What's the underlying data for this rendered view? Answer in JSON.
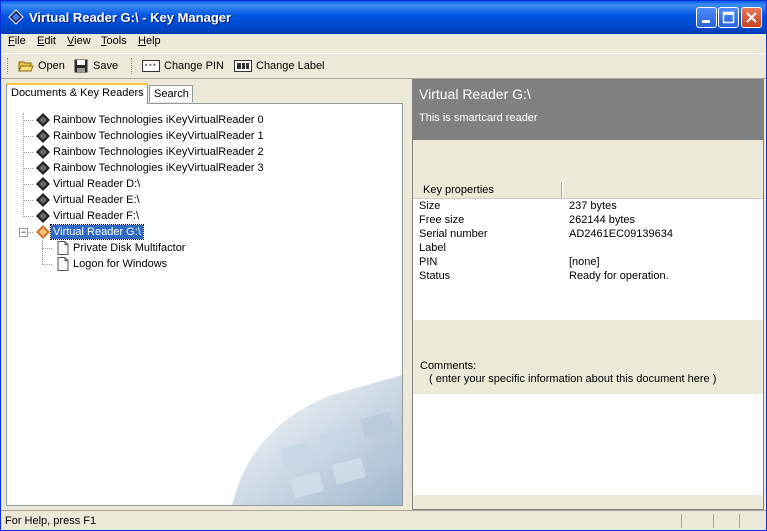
{
  "window": {
    "title": "Virtual Reader  G:\\ - Key Manager"
  },
  "menu": [
    {
      "label": "File",
      "accel": "F",
      "rest": "ile"
    },
    {
      "label": "Edit",
      "accel": "E",
      "rest": "dit"
    },
    {
      "label": "View",
      "accel": "V",
      "rest": "iew"
    },
    {
      "label": "Tools",
      "accel": "T",
      "rest": "ools"
    },
    {
      "label": "Help",
      "accel": "H",
      "rest": "elp"
    }
  ],
  "toolbar": {
    "open_label": "Open",
    "save_label": "Save",
    "change_pin_label": "Change PIN",
    "change_label_label": "Change Label"
  },
  "tabs": {
    "documents": "Documents & Key Readers",
    "search": "Search"
  },
  "tree": {
    "readers": [
      "Rainbow Technologies iKeyVirtualReader 0",
      "Rainbow Technologies iKeyVirtualReader 1",
      "Rainbow Technologies iKeyVirtualReader 2",
      "Rainbow Technologies iKeyVirtualReader 3",
      "Virtual Reader  D:\\",
      "Virtual Reader  E:\\",
      "Virtual Reader  F:\\",
      "Virtual Reader  G:\\"
    ],
    "children": [
      "Private Disk Multifactor",
      "Logon for Windows"
    ]
  },
  "details": {
    "title": "Virtual Reader  G:\\",
    "subtitle": "This is smartcard reader",
    "props_header": "Key properties",
    "props": [
      {
        "key": "Size",
        "value": "237 bytes"
      },
      {
        "key": "Free size",
        "value": "262144 bytes"
      },
      {
        "key": "Serial number",
        "value": "AD2461EC09139634"
      },
      {
        "key": "Label",
        "value": ""
      },
      {
        "key": "PIN",
        "value": "[none]"
      },
      {
        "key": "Status",
        "value": "Ready for operation."
      }
    ],
    "comments_label": "Comments:",
    "comments_text": "( enter your specific information about this document here )"
  },
  "status": {
    "text": "For Help, press F1"
  },
  "colors": {
    "title_bar": "#0054e3",
    "selection": "#316ac5",
    "panel_header": "#808080"
  }
}
